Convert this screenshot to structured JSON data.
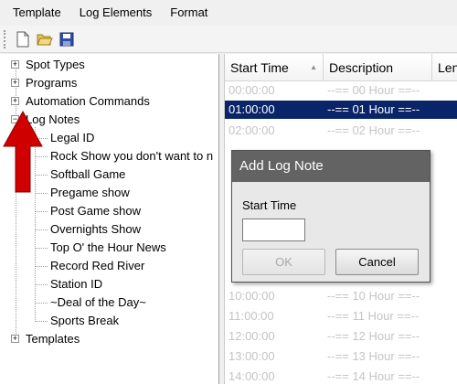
{
  "menu": {
    "items": [
      "Template",
      "Log Elements",
      "Format"
    ]
  },
  "toolbar": {
    "icons": [
      "new-file-icon",
      "open-folder-icon",
      "save-icon"
    ]
  },
  "tree": {
    "top_nodes": [
      {
        "label": "Spot Types",
        "expander": "+"
      },
      {
        "label": "Programs",
        "expander": "+"
      },
      {
        "label": "Automation Commands",
        "expander": "+"
      },
      {
        "label": "Log Notes",
        "expander": "−"
      }
    ],
    "children": [
      "Legal ID",
      "Rock Show you don't want to n",
      "Softball Game",
      "Pregame show",
      "Post Game show",
      "Overnights Show",
      "Top O' the Hour News",
      "Record Red River",
      "Station ID",
      "~Deal of the Day~",
      "Sports Break"
    ],
    "last_node": {
      "label": "Templates",
      "expander": "+"
    }
  },
  "grid": {
    "columns": [
      "Start Time",
      "Description",
      "Len"
    ],
    "sort_indicator": "▲",
    "rows": [
      {
        "time": "00:00:00",
        "desc": "--== 00 Hour ==--"
      },
      {
        "time": "01:00:00",
        "desc": "--== 01 Hour ==--"
      },
      {
        "time": "02:00:00",
        "desc": "--== 02 Hour ==--"
      },
      {
        "time": "10:00:00",
        "desc": "--== 10 Hour ==--"
      },
      {
        "time": "11:00:00",
        "desc": "--== 11 Hour ==--"
      },
      {
        "time": "12:00:00",
        "desc": "--== 12 Hour ==--"
      },
      {
        "time": "13:00:00",
        "desc": "--== 13 Hour ==--"
      },
      {
        "time": "14:00:00",
        "desc": "--== 14 Hour ==--"
      }
    ]
  },
  "dialog": {
    "title": "Add Log Note",
    "label": "Start Time",
    "value": "",
    "ok": "OK",
    "cancel": "Cancel"
  },
  "colors": {
    "selection": "#0a246a",
    "dialog_title": "#636363",
    "arrow": "#d00000"
  }
}
